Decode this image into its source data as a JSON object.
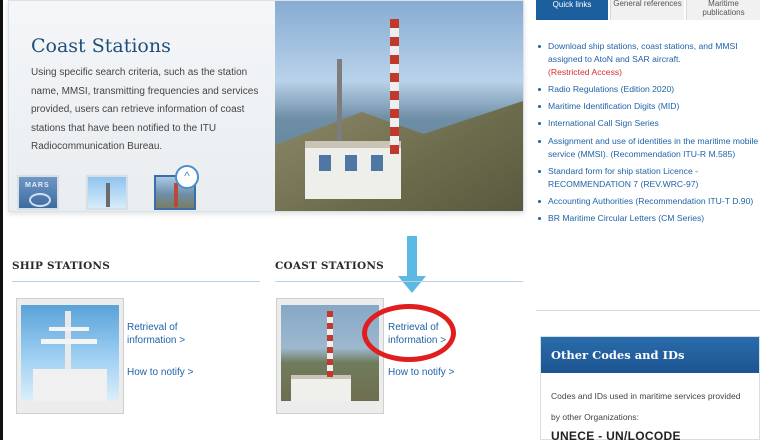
{
  "hero": {
    "title": "Coast Stations",
    "description": "Using specific search criteria, such as the station name, MMSI, transmitting frequencies and services provided, users can retrieve information of coast stations that have been notified to the ITU Radiocommunication Bureau.",
    "thumb_mars_label": "MARS",
    "up_symbol": "^"
  },
  "sections": {
    "ship": {
      "title": "SHIP STATIONS",
      "retrieval_label": "Retrieval of information >",
      "notify_label": "How to notify >"
    },
    "coast": {
      "title": "COAST STATIONS",
      "retrieval_label": "Retrieval of information >",
      "notify_label": "How to notify >"
    }
  },
  "right": {
    "tabs": [
      {
        "label": "Quick links"
      },
      {
        "label": "General references"
      },
      {
        "label": "Maritime publications"
      }
    ],
    "quick_links": [
      {
        "text": "Download ship stations, coast stations, and MMSI assigned to AtoN and SAR aircraft.",
        "note": "(Restricted Access)"
      },
      {
        "text": "Radio Regulations (Edition 2020)"
      },
      {
        "text": "Maritime Identification Digits (MID)"
      },
      {
        "text": "International Call Sign Series"
      },
      {
        "text": "Assignment and use of identities in the maritime mobile service (MMSI). (Recommendation ITU-R M.585)"
      },
      {
        "text": "Standard form for ship station Licence - RECOMMENDATION 7 (REV.WRC-97)"
      },
      {
        "text": "Accounting Authorities (Recommendation ITU-T D.90)"
      },
      {
        "text": "BR Maritime Circular Letters (CM Series)"
      }
    ],
    "other_codes": {
      "title": "Other Codes and IDs",
      "description": "Codes and IDs used in maritime services provided by other Organizations:",
      "unece": "UNECE - UN/LOCODE"
    }
  },
  "colors": {
    "accent_blue": "#1c5f9e",
    "link_blue": "#1f62a8",
    "highlight_red": "#e01e1e",
    "arrow_blue": "#5bb9e4"
  }
}
